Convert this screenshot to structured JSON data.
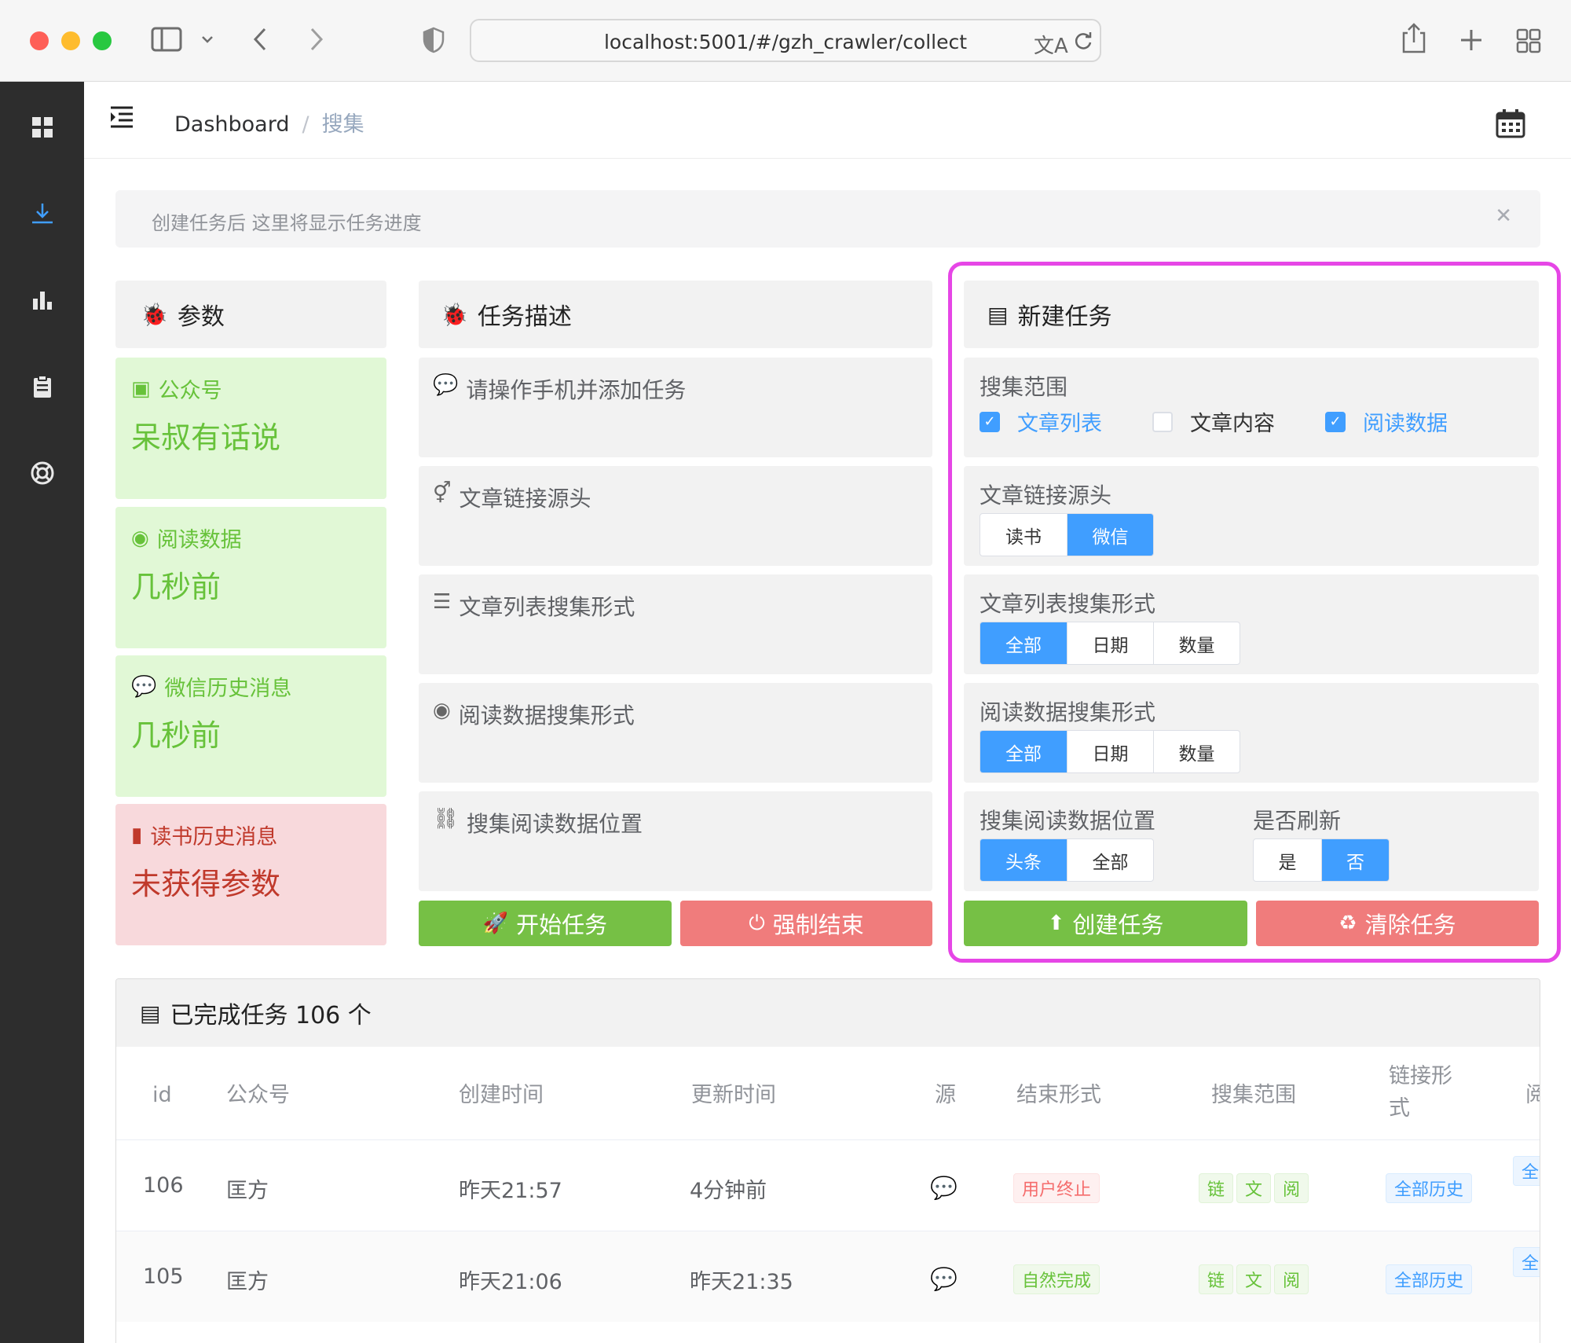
{
  "browser": {
    "url": "localhost:5001/#/gzh_crawler/collect"
  },
  "header": {
    "breadcrumb_home": "Dashboard",
    "breadcrumb_current": "搜集"
  },
  "alert": {
    "text": "创建任务后 这里将显示任务进度"
  },
  "params": {
    "title": "参数",
    "cards": [
      {
        "label": "公众号",
        "value": "呆叔有话说",
        "status": "ok",
        "icon": "id-card-icon"
      },
      {
        "label": "阅读数据",
        "value": "几秒前",
        "status": "ok",
        "icon": "eye-icon"
      },
      {
        "label": "微信历史消息",
        "value": "几秒前",
        "status": "ok",
        "icon": "wechat-icon"
      },
      {
        "label": "读书历史消息",
        "value": "未获得参数",
        "status": "bad",
        "icon": "book-icon"
      }
    ]
  },
  "task_desc": {
    "title": "任务描述",
    "items": [
      {
        "text": "请操作手机并添加任务",
        "icon": "wechat-icon"
      },
      {
        "text": "文章链接源头",
        "icon": "mars-venus-icon"
      },
      {
        "text": "文章列表搜集形式",
        "icon": "list-icon"
      },
      {
        "text": "阅读数据搜集形式",
        "icon": "eye-icon"
      },
      {
        "text": "搜集阅读数据位置",
        "icon": "unlink-icon"
      }
    ],
    "start_button": "开始任务",
    "stop_button": "强制结束"
  },
  "new_task": {
    "title": "新建任务",
    "scope_label": "搜集范围",
    "scope_options": [
      {
        "label": "文章列表",
        "checked": true
      },
      {
        "label": "文章内容",
        "checked": false
      },
      {
        "label": "阅读数据",
        "checked": true
      }
    ],
    "source_label": "文章链接源头",
    "source_options": [
      "读书",
      "微信"
    ],
    "source_selected": "微信",
    "list_mode_label": "文章列表搜集形式",
    "list_mode_options": [
      "全部",
      "日期",
      "数量"
    ],
    "list_mode_selected": "全部",
    "read_mode_label": "阅读数据搜集形式",
    "read_mode_options": [
      "全部",
      "日期",
      "数量"
    ],
    "read_mode_selected": "全部",
    "position_label": "搜集阅读数据位置",
    "position_options": [
      "头条",
      "全部"
    ],
    "position_selected": "头条",
    "refresh_label": "是否刷新",
    "refresh_options": [
      "是",
      "否"
    ],
    "refresh_selected": "否",
    "create_button": "创建任务",
    "clear_button": "清除任务"
  },
  "completed": {
    "title": "已完成任务 106 个",
    "columns": [
      "id",
      "公众号",
      "创建时间",
      "更新时间",
      "源",
      "结束形式",
      "搜集范围",
      "链接形",
      "式",
      "阅"
    ],
    "rows": [
      {
        "id": "106",
        "account": "匡方",
        "created": "昨天21:57",
        "updated": "4分钟前",
        "end": "用户终止",
        "end_type": "danger",
        "scope": [
          "链",
          "文",
          "阅"
        ],
        "link": "全部历史",
        "extra": "全"
      },
      {
        "id": "105",
        "account": "匡方",
        "created": "昨天21:06",
        "updated": "昨天21:35",
        "end": "自然完成",
        "end_type": "success",
        "scope": [
          "链",
          "文",
          "阅"
        ],
        "link": "全部历史",
        "extra": "全"
      }
    ]
  },
  "colors": {
    "primary": "#409eff",
    "success": "#76c045",
    "danger": "#f07c7c",
    "highlight": "#e646e6"
  }
}
